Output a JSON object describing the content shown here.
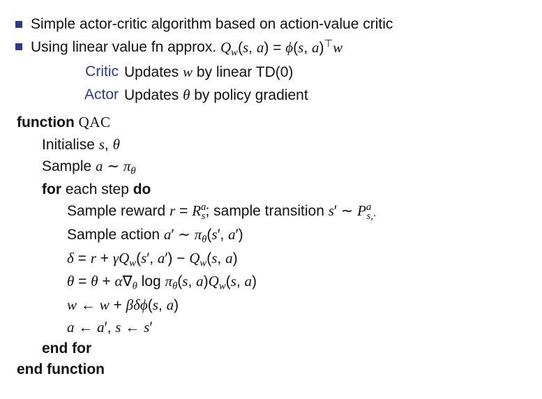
{
  "bullets": {
    "b1": "Simple actor-critic algorithm based on action-value critic",
    "b2_pre": "Using linear value fn approx.  ",
    "b2_eq": "Q_w(s,a) = φ(s,a)^T w"
  },
  "defs": {
    "critic_term": "Critic",
    "critic_pre": "Updates ",
    "critic_var": "w",
    "critic_post": " by linear TD(0)",
    "actor_term": "Actor",
    "actor_pre": "Updates ",
    "actor_var": "θ",
    "actor_post": " by policy gradient"
  },
  "algo": {
    "fn_kw": "function",
    "fn_name": "QAC",
    "init_pre": "Initialise ",
    "init_vars": "s, θ",
    "sample_a_pre": "Sample ",
    "sample_a_expr": "a ∼ π_θ",
    "for_kw": "for",
    "for_cond": " each step ",
    "do_kw": "do",
    "step_reward_pre": "Sample reward ",
    "step_reward_eq": "r = R_s^a",
    "step_reward_mid": "; sample transition ",
    "step_trans_eq": "s′ ∼ P_{s,·}^a",
    "step_action_pre": "Sample action ",
    "step_action_eq": "a′ ∼ π_θ(s′,a′)",
    "delta_eq": "δ = r + γ Q_w(s′,a′) − Q_w(s,a)",
    "theta_eq": "θ = θ + α ∇_θ log π_θ(s,a) Q_w(s,a)",
    "w_eq": "w ← w + β δ φ(s,a)",
    "assign_eq": "a ← a′, s ← s′",
    "endfor_kw": "end for",
    "endfn_kw": "end function"
  }
}
